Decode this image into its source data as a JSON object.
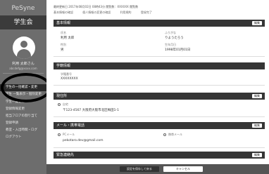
{
  "sidebar": {
    "brand": "PeSyne",
    "role": "学生会",
    "user_name": "利用 太郎さん",
    "user_email": "abcdefg@xxxx.com",
    "items": [
      {
        "label": "学生の一括確認・変更"
      },
      {
        "label": "学生 一覧表示・個別変更"
      },
      {
        "label": "学生一覧登録"
      },
      {
        "label": "登録情報変更"
      },
      {
        "label": "担当フロアの割り当て"
      },
      {
        "label": "登録申請"
      },
      {
        "label": "教室・入出時間・ログ"
      },
      {
        "label": "ログアウト"
      }
    ]
  },
  "main": {
    "topline": "最終更新日 2017年08月02日 08時43分  閲覧数：XXXXXX 閲覧数",
    "steps": [
      "基本情報の確認",
      "個人情報の変更の確認",
      "利用規約",
      "登録完了"
    ],
    "sections": {
      "basic": {
        "title": "基本情報",
        "edit": "編集",
        "fields": [
          {
            "label": "氏名",
            "value": "利用 太郎"
          },
          {
            "label": "ふりがな",
            "value": "りようたろう"
          },
          {
            "label": "性別",
            "value": "男"
          },
          {
            "label": "生年月日",
            "value": "1998年01月01日"
          }
        ]
      },
      "student": {
        "title": "学籍情報",
        "edit": "編集",
        "fields": [
          {
            "label": "学籍番号",
            "value": "XXXXXXXX"
          }
        ]
      },
      "address": {
        "title": "現住所",
        "edit": "編集",
        "option": "自宅",
        "value": "〒123-4567 大阪府大阪市北区梅田1-1"
      },
      "contact": {
        "title": "メール・携帯電話",
        "edit": "編集",
        "option_email": "PCメール",
        "option_phone": "携帯メール",
        "email_value": "pekotaro.dev@gmail.com"
      },
      "emergency": {
        "title": "緊急連絡先",
        "edit": "編集"
      }
    }
  },
  "footer": {
    "primary": "設定を保存して戻る",
    "secondary": "キャンセル"
  }
}
